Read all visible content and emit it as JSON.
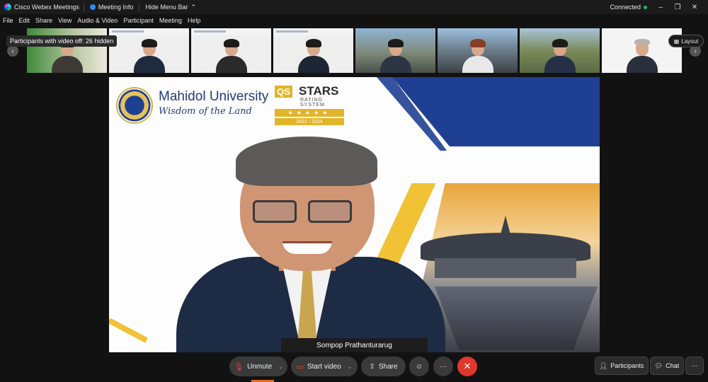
{
  "titlebar": {
    "app_name": "Cisco Webex Meetings",
    "meeting_info": "Meeting Info",
    "hide_menu": "Hide Menu Bar",
    "status": "Connected"
  },
  "menubar": [
    "File",
    "Edit",
    "Share",
    "View",
    "Audio & Video",
    "Participant",
    "Meeting",
    "Help"
  ],
  "filmstrip": {
    "tooltip": "Participants with video off: 26 hidden",
    "layout_label": "Layout"
  },
  "stage": {
    "university_name": "Mahidol University",
    "motto": "Wisdom of the Land",
    "qs_label": "QS",
    "stars_word": "STARS",
    "rating_system": "RATING SYSTEM",
    "star_row": "★★★★★",
    "years": "2021 - 2024",
    "speaker_name": "Sompop Prathanturarug"
  },
  "controls": {
    "unmute": "Unmute",
    "start_video": "Start video",
    "share": "Share",
    "participants": "Participants",
    "chat": "Chat"
  }
}
